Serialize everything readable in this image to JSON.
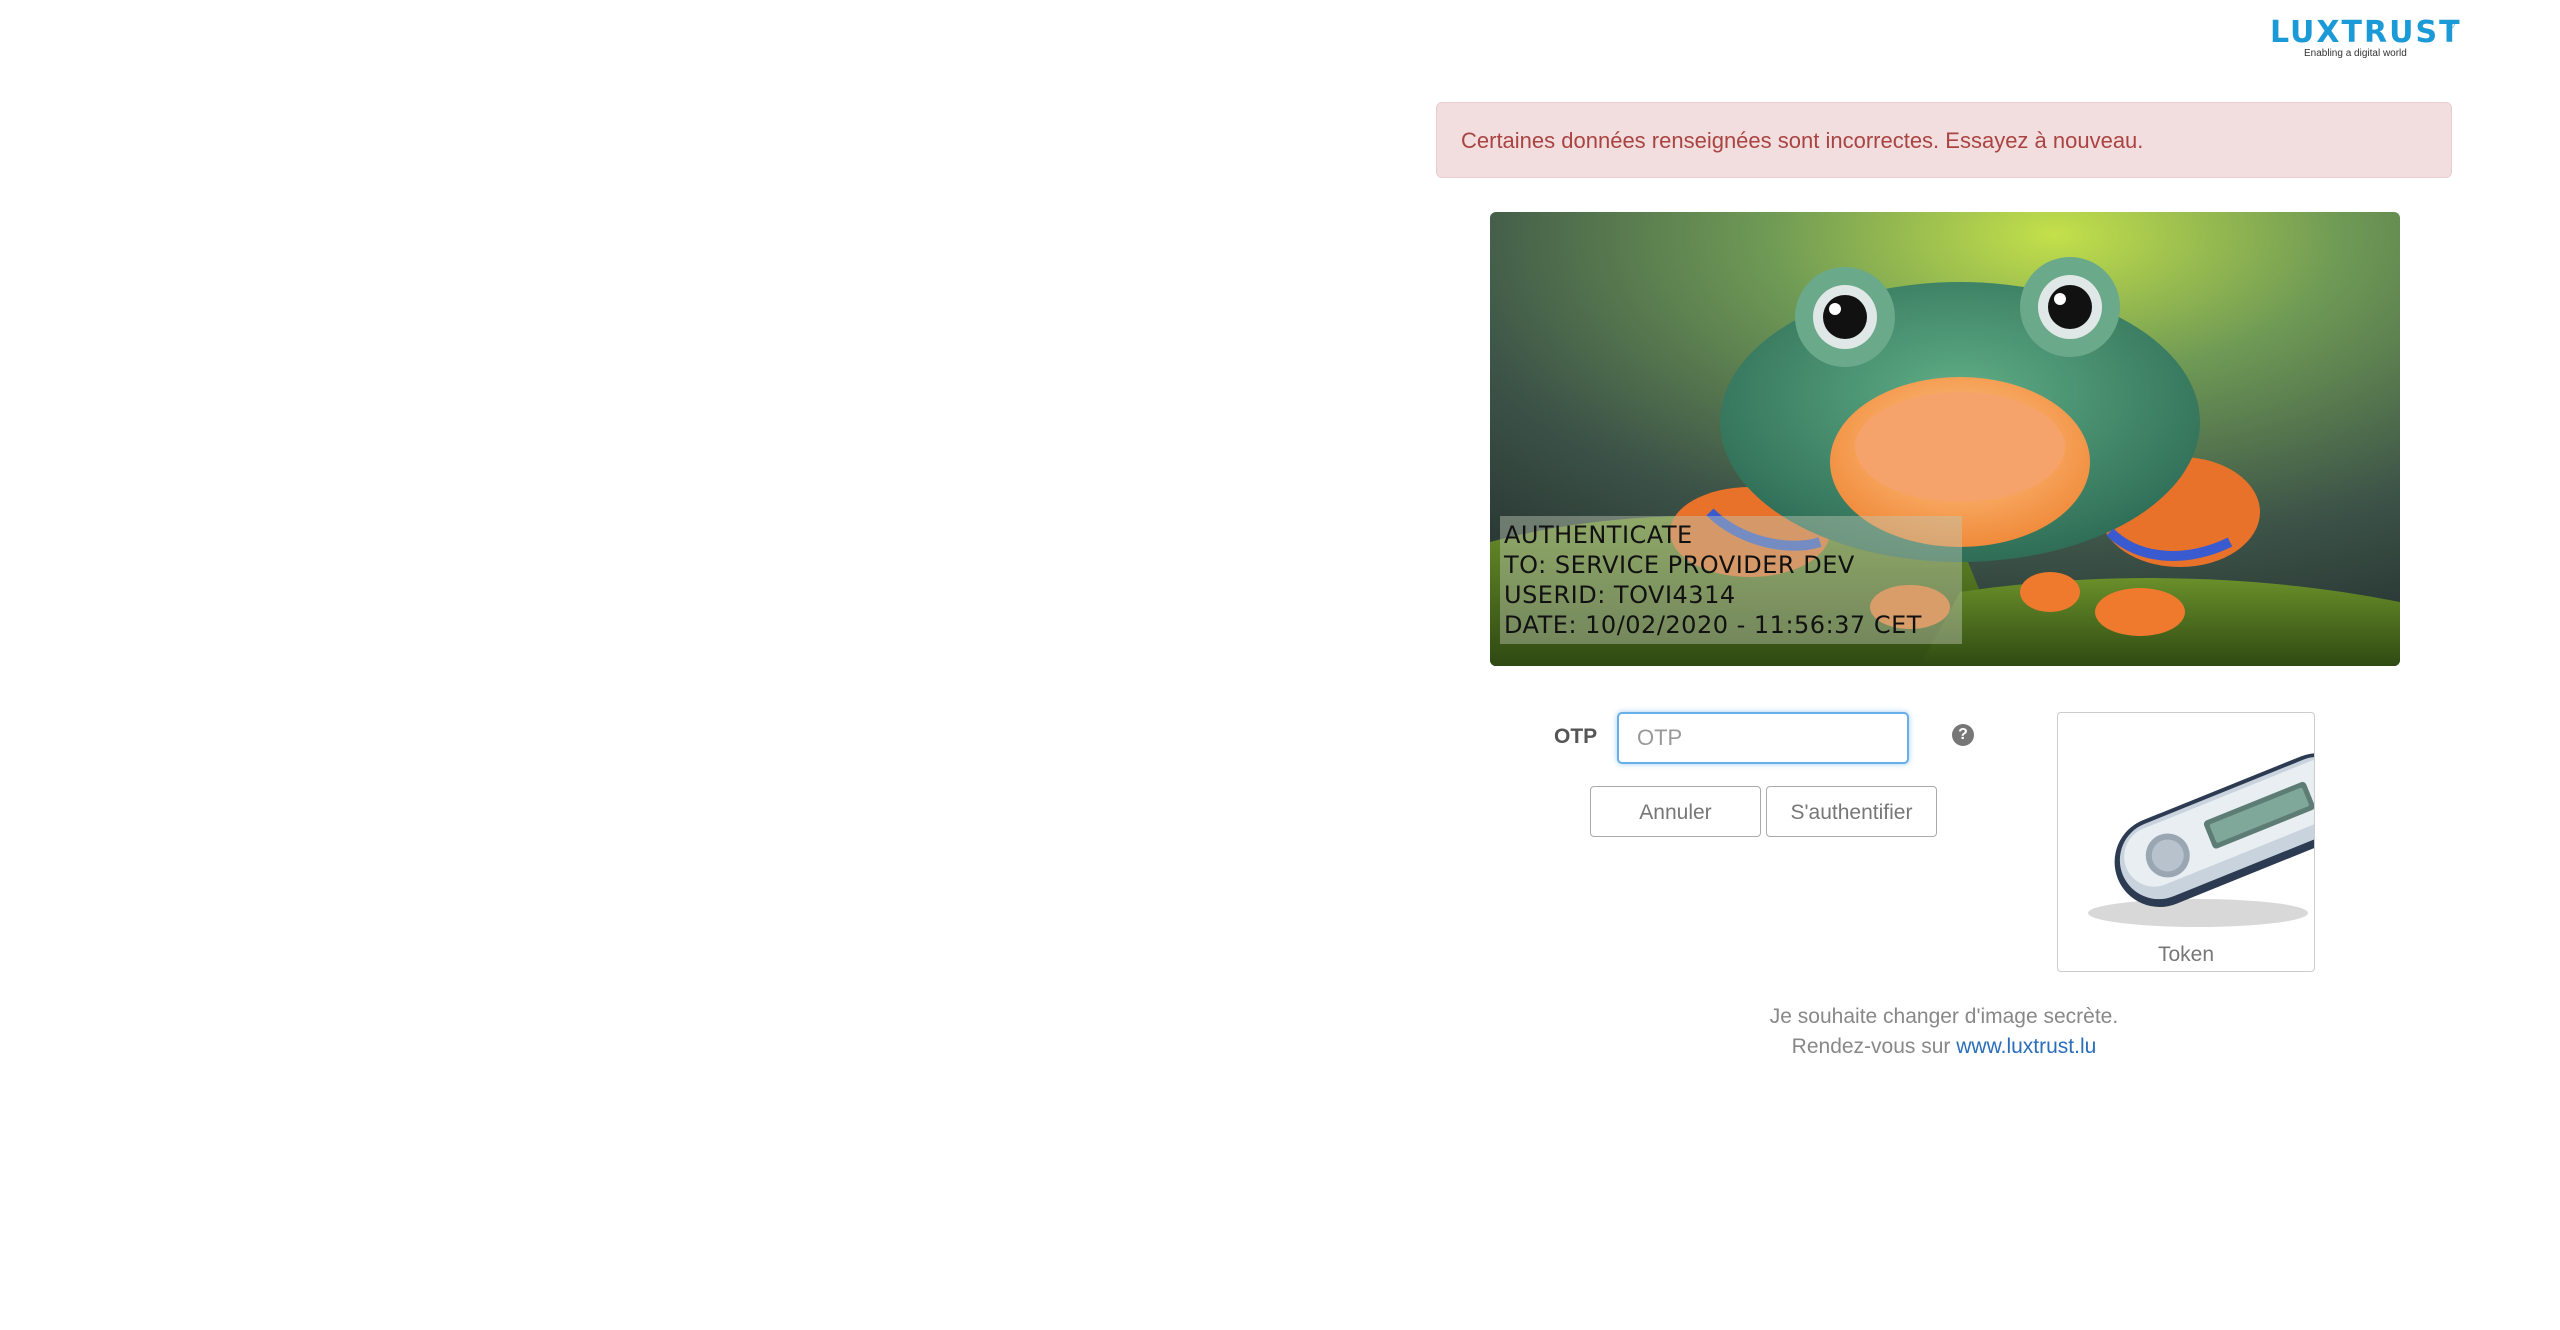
{
  "logo": {
    "name": "LUXTRUST",
    "registered": "®",
    "tagline": "Enabling a digital world"
  },
  "alert": {
    "message": "Certaines données renseignées sont incorrectes. Essayez à nouveau."
  },
  "secret_image": {
    "lines": [
      "AUTHENTICATE",
      "TO: SERVICE PROVIDER DEV",
      "USERID: TOVI4314",
      "DATE: 10/02/2020 - 11:56:37 CET"
    ]
  },
  "form": {
    "otp_label": "OTP",
    "otp_placeholder": "OTP",
    "otp_value": "",
    "cancel_label": "Annuler",
    "auth_label": "S'authentifier",
    "help_icon": "question-circle-icon"
  },
  "token": {
    "label": "Token"
  },
  "footer": {
    "line1": "Je souhaite changer d'image secrète.",
    "line2_prefix": "Rendez-vous sur",
    "link_text": "www.luxtrust.lu"
  },
  "colors": {
    "brand": "#1a9ad6",
    "alert_bg": "#f2dede",
    "alert_text": "#a94442",
    "link": "#2a6ebb",
    "focus": "#66afe9"
  }
}
